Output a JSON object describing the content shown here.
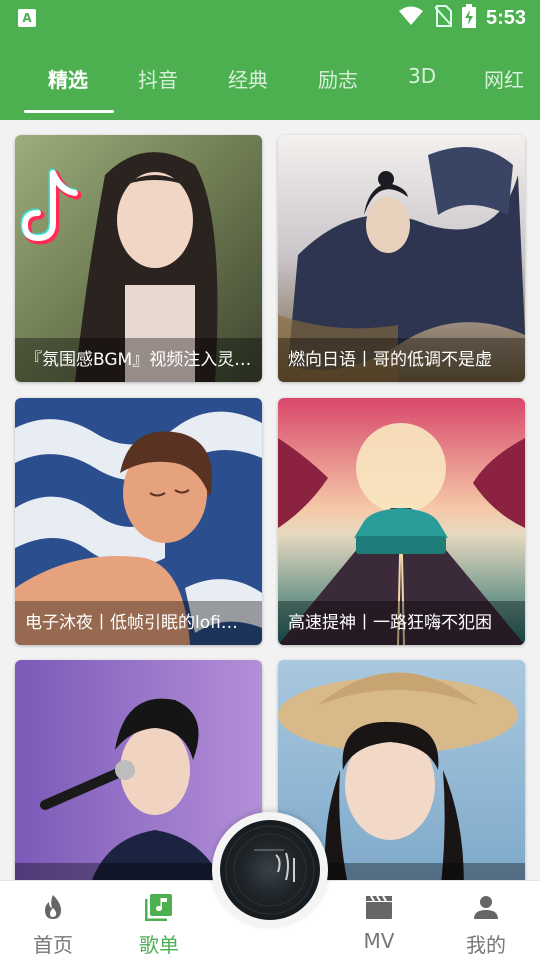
{
  "status_bar": {
    "time": "5:53",
    "app_icon": "A",
    "icons": [
      "wifi-icon",
      "no-sim-icon",
      "battery-charging-icon"
    ]
  },
  "tabs": [
    {
      "label": "精选",
      "active": true
    },
    {
      "label": "抖音",
      "active": false
    },
    {
      "label": "经典",
      "active": false
    },
    {
      "label": "励志",
      "active": false
    },
    {
      "label": "3D",
      "active": false
    },
    {
      "label": "网红",
      "active": false
    }
  ],
  "playlists": [
    {
      "title": "『氛围感BGM』视频注入灵魂的神仙配乐"
    },
    {
      "title": "燃向日语丨哥的低调不是虚"
    },
    {
      "title": "电子沐夜丨低帧引眠的lofi小调"
    },
    {
      "title": "高速提神丨一路狂嗨不犯困"
    },
    {
      "title": ""
    },
    {
      "title": ""
    }
  ],
  "bottom_nav": [
    {
      "label": "首页",
      "icon": "flame-icon",
      "active": false
    },
    {
      "label": "歌单",
      "icon": "music-note-icon",
      "active": true
    },
    {
      "label": "MV",
      "icon": "clapperboard-icon",
      "active": false
    },
    {
      "label": "我的",
      "icon": "person-icon",
      "active": false
    }
  ],
  "now_playing": {
    "icon": "album-disc"
  },
  "colors": {
    "brand": "#4caf50",
    "nav_inactive": "#777777",
    "background": "#f2f2f2"
  }
}
